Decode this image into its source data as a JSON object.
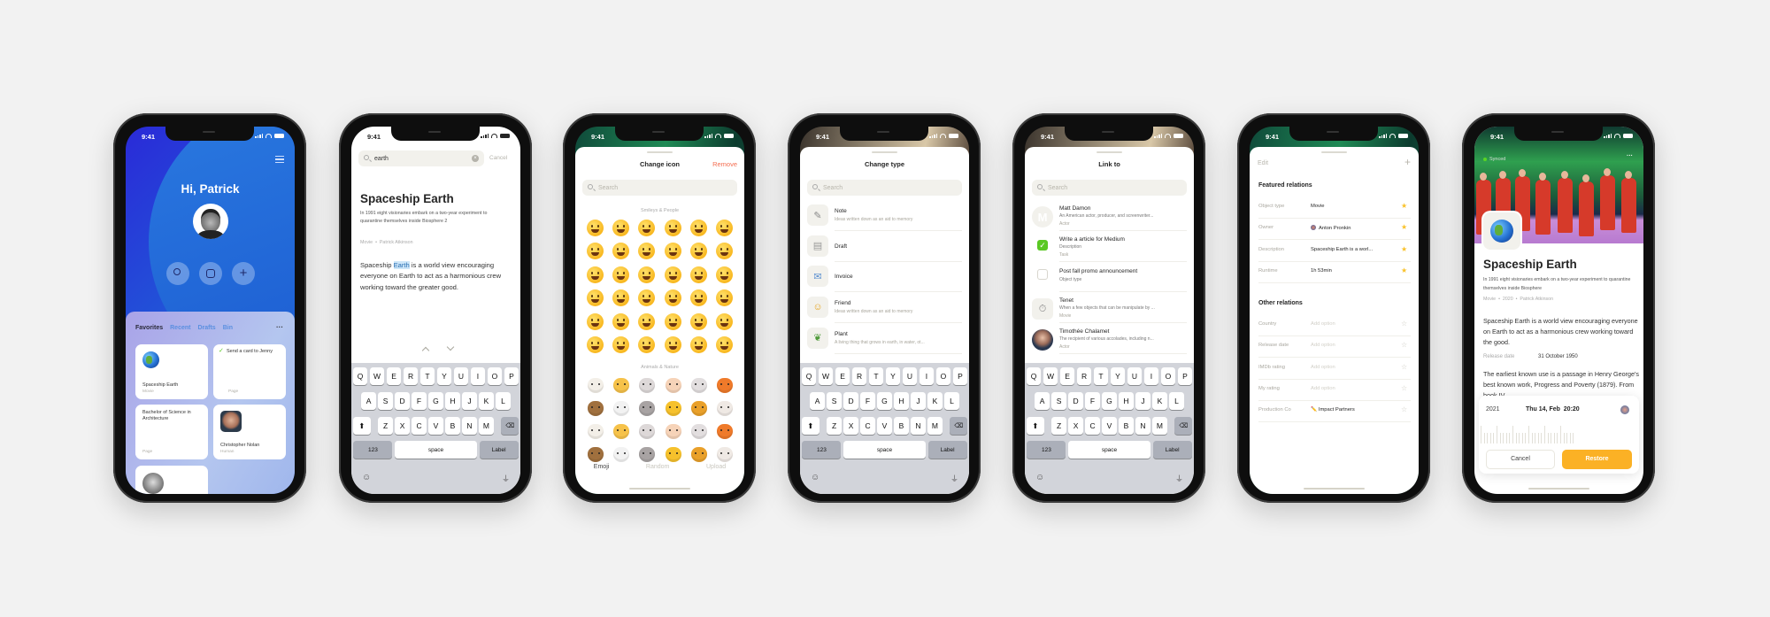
{
  "status": {
    "time": "9:41"
  },
  "keyboard": {
    "rows": [
      [
        "Q",
        "W",
        "E",
        "R",
        "T",
        "Y",
        "U",
        "I",
        "O",
        "P"
      ],
      [
        "A",
        "S",
        "D",
        "F",
        "G",
        "H",
        "J",
        "K",
        "L"
      ],
      [
        "Z",
        "X",
        "C",
        "V",
        "B",
        "N",
        "M"
      ]
    ],
    "num_label": "123",
    "space_label": "space",
    "action_label": "Label"
  },
  "home": {
    "greeting": "Hi, Patrick",
    "tabs": [
      {
        "label": "Favorites",
        "active": true
      },
      {
        "label": "Recent"
      },
      {
        "label": "Drafts"
      },
      {
        "label": "Bin"
      }
    ],
    "more_label": "···",
    "cards": [
      {
        "title": "Spaceship Earth",
        "type": "Movie",
        "icon": "globe-icon"
      },
      {
        "title": "Send a card to Jenny",
        "type": "Page",
        "icon": "check-icon"
      },
      {
        "title": "Bachelor of Science in Architecture",
        "type": "Page"
      },
      {
        "title": "Christopher Nolan",
        "type": "Human",
        "icon": "avatar"
      }
    ],
    "colors": {
      "bg_start": "#2b2fd6",
      "bg_end": "#1b6fd6",
      "panel": "#b3b6ec",
      "tab_inactive": "#5b8fe0"
    }
  },
  "search_screen": {
    "query": "earth",
    "cancel_label": "Cancel",
    "title": "Spaceship Earth",
    "description": "In 1991 eight visionaries embark on a two-year experiment to quarantine themselves inside Biosphere 2",
    "meta": "Movie  •  Patrick Atkinson",
    "body_before": "Spaceship ",
    "body_highlight": "Earth",
    "body_after": " is a world view encouraging everyone on Earth to act as a harmonious crew working toward the greater good."
  },
  "change_icon": {
    "title": "Change icon",
    "remove_label": "Remove",
    "search_placeholder": "Search",
    "section_smileys": "Smileys & People",
    "section_animals": "Animals & Nature",
    "smileys": [
      "grinning",
      "grin",
      "joy",
      "rofl",
      "smiley",
      "smile",
      "sweat-smile",
      "laughing",
      "wink",
      "blush",
      "yum",
      "sunglasses",
      "heart-eyes",
      "kissing-heart",
      "kissing",
      "kissing-smiling-eyes",
      "yum",
      "tongue"
    ],
    "animals": [
      {
        "name": "dog",
        "color": "#f3efe8"
      },
      {
        "name": "cat",
        "color": "#f6c24a"
      },
      {
        "name": "mouse",
        "color": "#ddd8d8"
      },
      {
        "name": "hamster",
        "color": "#f6d3b8"
      },
      {
        "name": "rabbit",
        "color": "#e2dedf"
      },
      {
        "name": "fox",
        "color": "#ef7a2a"
      },
      {
        "name": "bear",
        "color": "#a0703e"
      },
      {
        "name": "panda",
        "color": "#f2f2f2"
      },
      {
        "name": "koala",
        "color": "#a8a3a3"
      },
      {
        "name": "tiger",
        "color": "#f6c12c"
      },
      {
        "name": "lion",
        "color": "#e9a02a"
      },
      {
        "name": "cow",
        "color": "#efe9e4"
      }
    ],
    "tabs": [
      {
        "label": "Emoji",
        "active": true
      },
      {
        "label": "Random"
      },
      {
        "label": "Upload"
      }
    ],
    "accent": "#f46d50"
  },
  "change_type": {
    "title": "Change type",
    "search_placeholder": "Search",
    "items": [
      {
        "name": "Note",
        "desc": "Ideas written down as an aid to memory",
        "icon": "notepad-icon"
      },
      {
        "name": "Draft",
        "desc": "",
        "icon": "document-icon"
      },
      {
        "name": "Invoice",
        "desc": "",
        "icon": "inbox-tray-icon"
      },
      {
        "name": "Friend",
        "desc": "Ideas written down as an aid to memory",
        "icon": "person-icon"
      },
      {
        "name": "Plant",
        "desc": "A living thing that grows in earth, in water, ot...",
        "icon": "herb-icon"
      }
    ]
  },
  "link_to": {
    "title": "Link to",
    "search_placeholder": "Search",
    "items": [
      {
        "name": "Matt Damon",
        "desc": "An American actor, producer, and screenwriter...",
        "type": "Actor",
        "kind": "letter",
        "letter": "M"
      },
      {
        "name": "Write a article for Medium",
        "desc": "Description",
        "type": "Task",
        "kind": "checked"
      },
      {
        "name": "Post fall promo announcement",
        "desc": "Object type",
        "type": "",
        "kind": "unchecked"
      },
      {
        "name": "Tenet",
        "desc": "When a few objects that can be manipulate by ...",
        "type": "Movie",
        "kind": "stopwatch"
      },
      {
        "name": "Timothée Chalamet",
        "desc": "The recipient of various accolades, including n...",
        "type": "Actor",
        "kind": "photo"
      }
    ],
    "check_color": "#5ac824"
  },
  "relations": {
    "edit_label": "Edit",
    "add_label": "+",
    "featured_title": "Featured relations",
    "featured": [
      {
        "label": "Object type",
        "value": "Movie",
        "starred": true
      },
      {
        "label": "Owner",
        "value": "Anton Pronkin",
        "starred": true,
        "avatar": true
      },
      {
        "label": "Description",
        "value": "Spaceship Earth is a worl...",
        "starred": true
      },
      {
        "label": "Runtime",
        "value": "1h 53min",
        "starred": true
      }
    ],
    "other_title": "Other relations",
    "other": [
      {
        "label": "Country",
        "value": "Add option",
        "placeholder": true
      },
      {
        "label": "Release date",
        "value": "Add option",
        "placeholder": true
      },
      {
        "label": "IMDb rating",
        "value": "Add option",
        "placeholder": true
      },
      {
        "label": "My rating",
        "value": "Add option",
        "placeholder": true
      },
      {
        "label": "Production Co",
        "value": "✏️ Impact Partners"
      }
    ],
    "star_color": "#f9c22b"
  },
  "history": {
    "synced_label": "Synced",
    "more_label": "···",
    "title": "Spaceship Earth",
    "description": "In 1991 eight visionaries embark on a two-year experiment to quarantine themselves inside Biosphere",
    "meta": "Movie  •  2020  •  Patrick Atkinson",
    "body": "Spaceship Earth is a world view encouraging everyone on Earth to act as a harmonious crew working toward the good.",
    "release_label": "Release date",
    "release_value": "31 October 1950",
    "body2": "The earliest known use is a passage in Henry George's best known work, Progress and Poverty (1879). From book IV",
    "year": "2021",
    "datetime": "Thu 14, Feb  20:20",
    "cancel_label": "Cancel",
    "restore_label": "Restore",
    "accent": "#fbb125"
  }
}
